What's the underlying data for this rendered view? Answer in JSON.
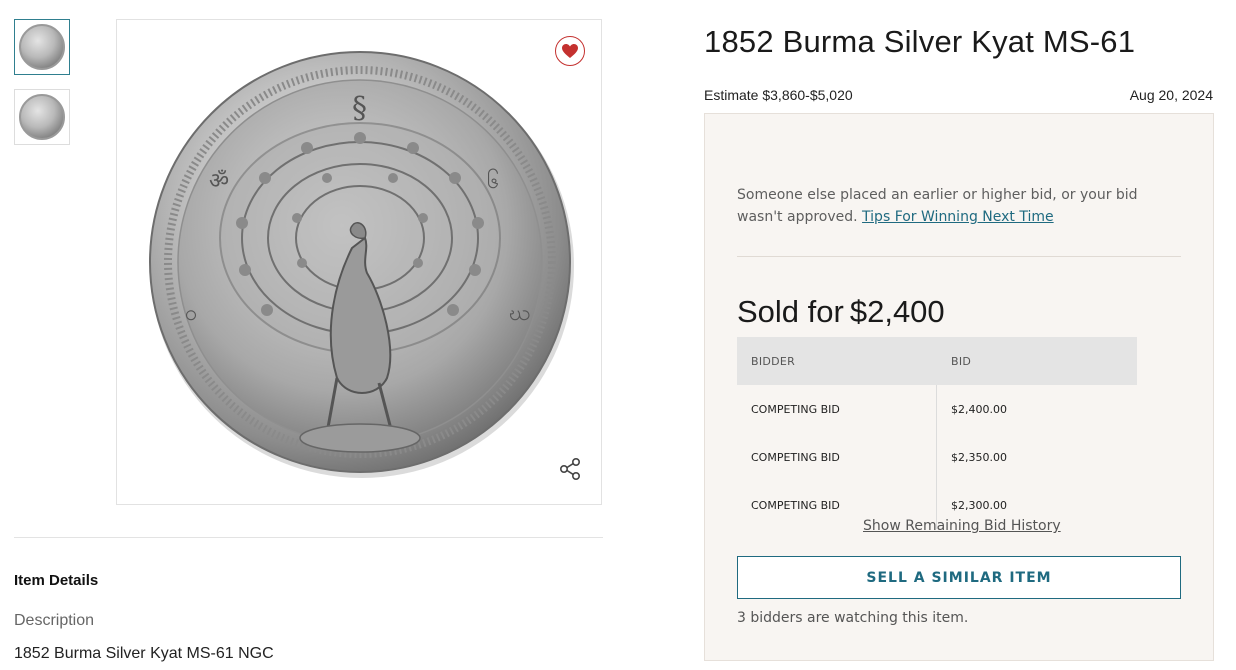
{
  "gallery": {
    "thumbnails": [
      "coin-obverse",
      "coin-reverse"
    ],
    "favorite_icon": "heart-icon",
    "share_icon": "share-icon"
  },
  "lot": {
    "title": "1852 Burma Silver Kyat MS-61",
    "estimate": "Estimate $3,860-$5,020",
    "date": "Aug 20, 2024"
  },
  "bid_panel": {
    "notice_text": "Someone else placed an earlier or higher bid, or your bid wasn't approved.",
    "notice_link": "Tips For Winning Next Time",
    "sold_label": "Sold for",
    "sold_amount": "$2,400",
    "table": {
      "headers": [
        "BIDDER",
        "BID"
      ],
      "rows": [
        {
          "bidder": "COMPETING BID",
          "bid": "$2,400.00"
        },
        {
          "bidder": "COMPETING BID",
          "bid": "$2,350.00"
        },
        {
          "bidder": "COMPETING BID",
          "bid": "$2,300.00"
        }
      ]
    },
    "show_remaining": "Show Remaining Bid History",
    "sell_button": "SELL A SIMILAR ITEM",
    "watchers": "3 bidders are watching this item."
  },
  "details": {
    "heading": "Item Details",
    "description_label": "Description",
    "description_text": "1852 Burma Silver Kyat MS-61 NGC"
  },
  "colors": {
    "accent": "#1f6a80",
    "heart": "#c4312f",
    "panel_bg": "#f8f5f2"
  }
}
